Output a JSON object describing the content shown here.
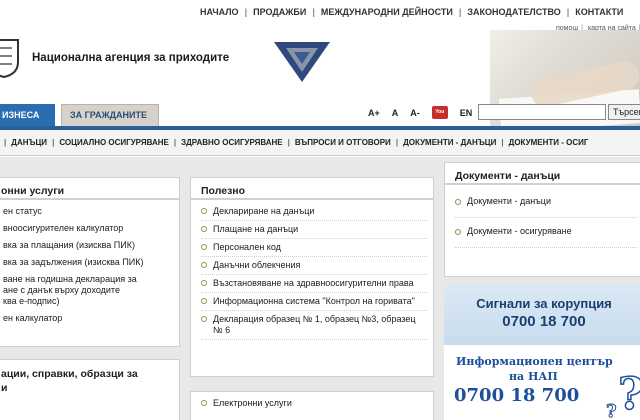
{
  "top_nav": [
    "НАЧАЛО",
    "ПРОДАЖБИ",
    "МЕЖДУНАРОДНИ ДЕЙНОСТИ",
    "ЗАКОНОДАТЕЛСТВО",
    "КОНТАКТИ"
  ],
  "sub_nav": [
    "помощ",
    "карта на сайта",
    "info"
  ],
  "agency_name": "Национална агенция за приходите",
  "tabs": {
    "business": "ИЗНЕСА",
    "citizens": "ЗА ГРАЖДАНИТЕ"
  },
  "tools": {
    "font_plus": "A+",
    "font_a": "A",
    "font_minus": "A-",
    "youtube": "You Tube",
    "lang": "EN"
  },
  "search": {
    "value": "",
    "button": "Търсене"
  },
  "main_nav": [
    "ДАНЪЦИ",
    "СОЦИАЛНО ОСИГУРЯВАНЕ",
    "ЗДРАВНО ОСИГУРЯВАНЕ",
    "ВЪПРОСИ И ОТГОВОРИ",
    "ДОКУМЕНТИ - ДАНЪЦИ",
    "ДОКУМЕНТИ - ОСИГ"
  ],
  "left_panel": {
    "title": "онни услуги",
    "items": [
      "ен статус",
      "вноосигурителен калкулатор",
      "вка за плащания (изисква ПИК)",
      "вка за задължения (изисква ПИК)",
      "ване на годишна декларация за\nане с данък върху доходите\nква е-подпис)",
      "ен калкулатор"
    ]
  },
  "left_panel2": {
    "title": "ации, справки, образци за\nи"
  },
  "mid_panel": {
    "title": "Полезно",
    "items": [
      "Деклариране на данъци",
      "Плащане на данъци",
      "Персонален код",
      "Данъчни облекчения",
      "Възстановяване на здравноосигурителни права",
      "Информационна система \"Контрол на горивата\"",
      "Декларация образец № 1, образец №3, образец № 6"
    ]
  },
  "mid_panel2": {
    "items": [
      "Електронни услуги"
    ]
  },
  "right_panel": {
    "title": "Документи - данъци",
    "items": [
      "Документи - данъци",
      "Документи - осигуряване"
    ]
  },
  "corruption": {
    "title": "Сигнали за корупция",
    "phone": "0700 18 700"
  },
  "info_center": {
    "title": "Информационен център",
    "sub": "на НАП",
    "phone": "0700 18 700"
  }
}
